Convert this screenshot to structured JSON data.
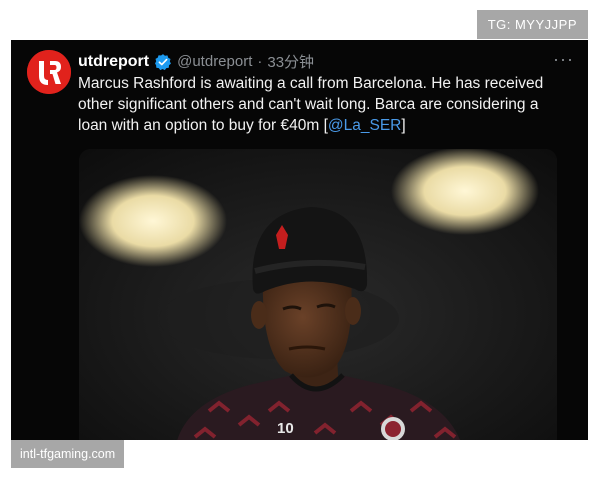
{
  "badge": {
    "label": "TG: MYYJJPP"
  },
  "tweet": {
    "avatar_letter": "U",
    "display_name": "utdreport",
    "handle": "@utdreport",
    "separator": "·",
    "timestamp": "33分钟",
    "text_before": "Marcus Rashford is awaiting a call from Barcelona. He has received other significant others and can't wait long. Barca are considering a loan with an option to buy for €40m [",
    "mention": "@La_SER",
    "text_after": "]",
    "more_label": "···",
    "image": {
      "beanie_logo": "devil",
      "shirt_number": "10"
    }
  },
  "watermark": {
    "label": "intl-tfgaming.com"
  },
  "colors": {
    "card_bg": "#060606",
    "avatar": "#e1221c",
    "verified": "#1d9bf0",
    "mention": "#4a9ae8",
    "muted": "#8b8f94",
    "badge_bg": "#a7a7a7"
  }
}
